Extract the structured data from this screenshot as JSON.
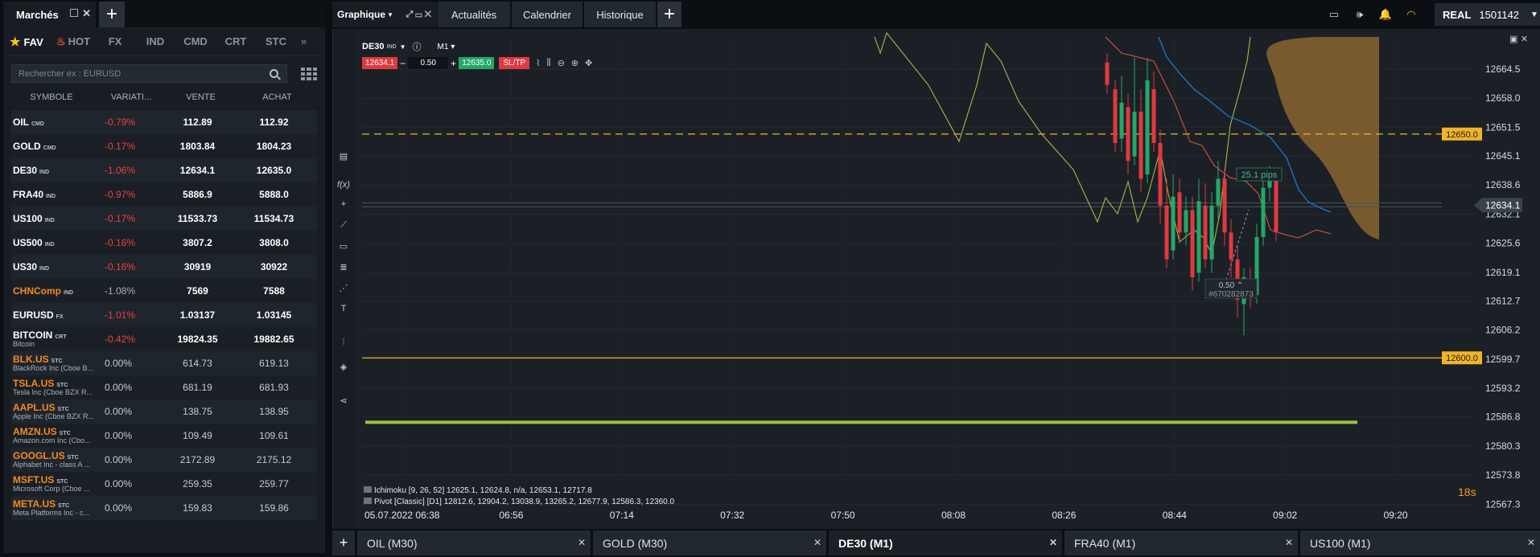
{
  "left_panel": {
    "tab_title": "Marchés",
    "categories": [
      "FAV",
      "HOT",
      "FX",
      "IND",
      "CMD",
      "CRT",
      "STC"
    ],
    "more": "»",
    "search_placeholder": "Rechercher ex : EURUSD",
    "columns": {
      "symbol": "SYMBOLE",
      "variation": "VARIATI...",
      "sell": "VENTE",
      "buy": "ACHAT"
    },
    "rows": [
      {
        "symbol": "OIL",
        "tag": "CMD",
        "sub": "",
        "variation": "-0.79%",
        "sell": "112.89",
        "buy": "112.92",
        "kind": "neg",
        "orange": false
      },
      {
        "symbol": "GOLD",
        "tag": "CMD",
        "sub": "",
        "variation": "-0.17%",
        "sell": "1803.84",
        "buy": "1804.23",
        "kind": "neg",
        "orange": false
      },
      {
        "symbol": "DE30",
        "tag": "IND",
        "sub": "",
        "variation": "-1.06%",
        "sell": "12634.1",
        "buy": "12635.0",
        "kind": "neg",
        "orange": false
      },
      {
        "symbol": "FRA40",
        "tag": "IND",
        "sub": "",
        "variation": "-0.97%",
        "sell": "5886.9",
        "buy": "5888.0",
        "kind": "neg",
        "orange": false
      },
      {
        "symbol": "US100",
        "tag": "IND",
        "sub": "",
        "variation": "-0.17%",
        "sell": "11533.73",
        "buy": "11534.73",
        "kind": "neg",
        "orange": false
      },
      {
        "symbol": "US500",
        "tag": "IND",
        "sub": "",
        "variation": "-0.16%",
        "sell": "3807.2",
        "buy": "3808.0",
        "kind": "neg",
        "orange": false
      },
      {
        "symbol": "US30",
        "tag": "IND",
        "sub": "",
        "variation": "-0.16%",
        "sell": "30919",
        "buy": "30922",
        "kind": "neg",
        "orange": false
      },
      {
        "symbol": "CHNComp",
        "tag": "IND",
        "sub": "",
        "variation": "-1.08%",
        "sell": "7569",
        "buy": "7588",
        "kind": "gray",
        "orange": true
      },
      {
        "symbol": "EURUSD",
        "tag": "FX",
        "sub": "",
        "variation": "-1.01%",
        "sell": "1.03137",
        "buy": "1.03145",
        "kind": "neg",
        "orange": false
      },
      {
        "symbol": "BITCOIN",
        "tag": "CRT",
        "sub": "Bitcoin",
        "variation": "-0.42%",
        "sell": "19824.35",
        "buy": "19882.65",
        "kind": "neg",
        "orange": false
      },
      {
        "symbol": "BLK.US",
        "tag": "STC",
        "sub": "BlackRock Inc (Cboe B...",
        "variation": "0.00%",
        "sell": "614.73",
        "buy": "619.13",
        "kind": "neutral",
        "orange": true
      },
      {
        "symbol": "TSLA.US",
        "tag": "STC",
        "sub": "Tesla Inc (Cboe BZX R...",
        "variation": "0.00%",
        "sell": "681.19",
        "buy": "681.93",
        "kind": "neutral",
        "orange": true
      },
      {
        "symbol": "AAPL.US",
        "tag": "STC",
        "sub": "Apple Inc (Cboe BZX R...",
        "variation": "0.00%",
        "sell": "138.75",
        "buy": "138.95",
        "kind": "neutral",
        "orange": true
      },
      {
        "symbol": "AMZN.US",
        "tag": "STC",
        "sub": "Amazon.com Inc (Cbo...",
        "variation": "0.00%",
        "sell": "109.49",
        "buy": "109.61",
        "kind": "neutral",
        "orange": true
      },
      {
        "symbol": "GOOGL.US",
        "tag": "STC",
        "sub": "Alphabet Inc - class A ...",
        "variation": "0.00%",
        "sell": "2172.89",
        "buy": "2175.12",
        "kind": "neutral",
        "orange": true
      },
      {
        "symbol": "MSFT.US",
        "tag": "STC",
        "sub": "Microsoft Corp (Cboe ...",
        "variation": "0.00%",
        "sell": "259.35",
        "buy": "259.77",
        "kind": "neutral",
        "orange": true
      },
      {
        "symbol": "META.US",
        "tag": "STC",
        "sub": "Meta Platforms Inc - c...",
        "variation": "0.00%",
        "sell": "159.83",
        "buy": "159.86",
        "kind": "neutral",
        "orange": true
      }
    ]
  },
  "topbar": {
    "graph_tab": "Graphique",
    "tabs": [
      "Actualités",
      "Calendrier",
      "Historique"
    ],
    "account_type": "REAL",
    "account_number": "1501142"
  },
  "chart": {
    "symbol": "DE30",
    "symbol_tag": "IND",
    "timeframe": "M1",
    "sell_price": "12634.1",
    "buy_price": "12635.0",
    "lot": "0.50",
    "sltp_label": "SL/TP",
    "pips_label": "25.1 pips",
    "position_volume": "0.50",
    "position_id": "#670282873",
    "indicators": [
      "Ichimoku [9, 26, 52] 12625.1, 12624.8, n/a, 12653.1, 12717.8",
      "Pivot [Classic] [D1] 12812.6, 12904.2, 13038.9, 13265.2, 12677.9, 12586.3, 12360.0"
    ],
    "countdown": "18s",
    "price_axis": [
      "12664.5",
      "12658.0",
      "12651.5",
      "12645.1",
      "12638.6",
      "12632.1",
      "12625.6",
      "12619.1",
      "12612.7",
      "12606.2",
      "12599.7",
      "12593.2",
      "12586.8",
      "12580.3",
      "12573.8",
      "12567.3"
    ],
    "current_price_label": "12634.1",
    "level_labels": [
      "12650.0",
      "12600.0"
    ],
    "time_axis": [
      "05.07.2022 06:38",
      "06:56",
      "07:14",
      "07:32",
      "07:50",
      "08:08",
      "08:26",
      "08:44",
      "09:02",
      "09:20"
    ],
    "colors": {
      "up": "#25a76a",
      "down": "#e0393f",
      "ichimoku_lag": "#a6b84a",
      "kijun": "#1e7fd6",
      "tenkan": "#e0593f",
      "cloud": "#8a6530",
      "level": "#f0b429",
      "green_line": "#9bc53d"
    }
  },
  "bottom_tabs": [
    {
      "label": "OIL (M30)",
      "active": false
    },
    {
      "label": "GOLD (M30)",
      "active": false
    },
    {
      "label": "DE30 (M1)",
      "active": true
    },
    {
      "label": "FRA40 (M1)",
      "active": false
    },
    {
      "label": "US100 (M1)",
      "active": false
    }
  ]
}
